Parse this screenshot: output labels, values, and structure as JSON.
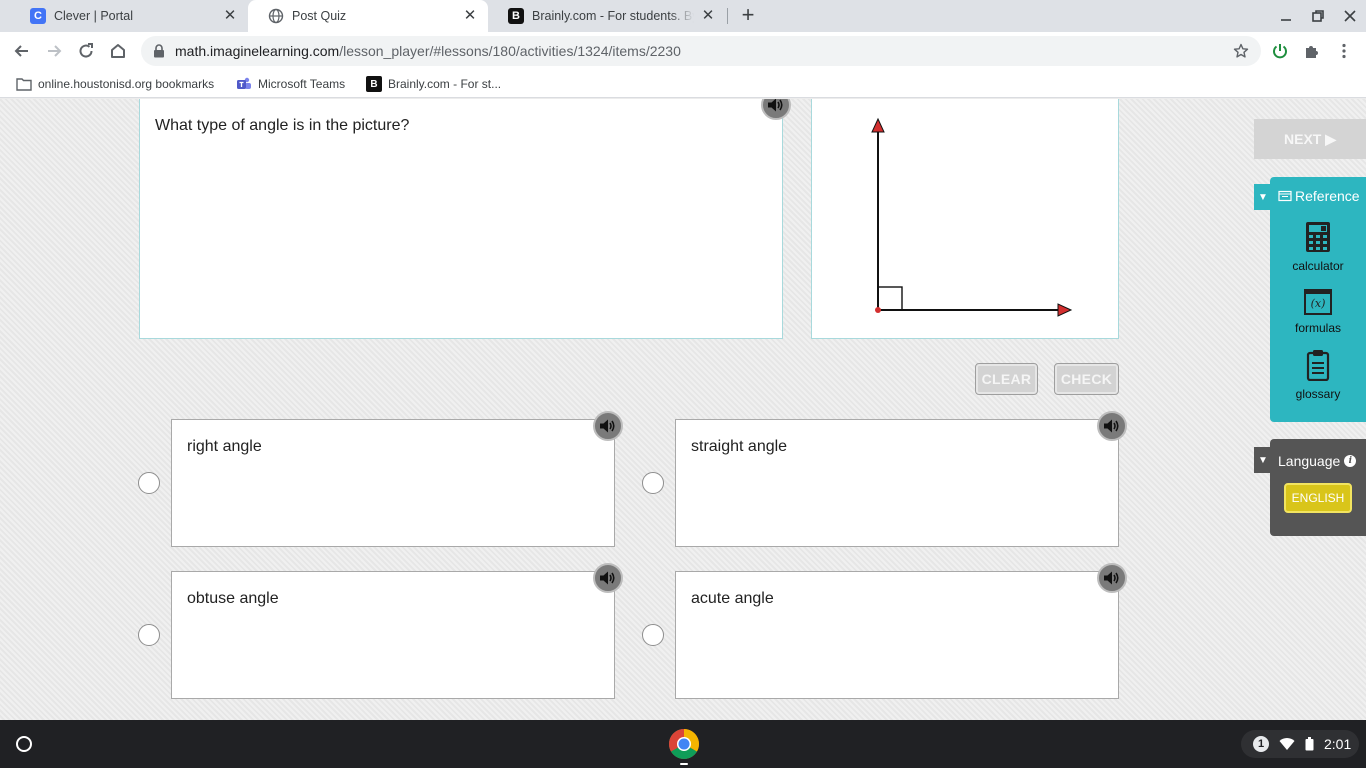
{
  "browser": {
    "tabs": [
      {
        "title": "Clever | Portal",
        "favicon": "clever-icon",
        "favicon_letter": "C",
        "active": false
      },
      {
        "title": "Post Quiz",
        "favicon": "globe-icon",
        "active": true
      },
      {
        "title": "Brainly.com - For students. By st",
        "favicon": "brainly-icon",
        "favicon_letter": "B",
        "active": false
      }
    ],
    "url": {
      "host": "math.imaginelearning.com",
      "path": "/lesson_player/#lessons/180/activities/1324/items/2230"
    },
    "bookmarks": [
      {
        "label": "online.houstonisd.org bookmarks",
        "icon": "folder-icon"
      },
      {
        "label": "Microsoft Teams",
        "icon": "teams-icon"
      },
      {
        "label": "Brainly.com - For st...",
        "icon": "brainly-icon",
        "icon_letter": "B"
      }
    ]
  },
  "quiz": {
    "question": "What type of angle is in the picture?",
    "buttons": {
      "clear": "CLEAR",
      "check": "CHECK",
      "next": "NEXT ▶"
    },
    "choices": [
      {
        "label": "right angle"
      },
      {
        "label": "straight angle"
      },
      {
        "label": "obtuse angle"
      },
      {
        "label": "acute angle"
      }
    ],
    "figure": {
      "type": "right-angle-diagram",
      "arrow_color": "#d32f2f"
    }
  },
  "reference": {
    "title": "Reference",
    "items": [
      {
        "label": "calculator",
        "icon": "calculator-icon"
      },
      {
        "label": "formulas",
        "icon": "formula-icon",
        "glyph": "(x)"
      },
      {
        "label": "glossary",
        "icon": "clipboard-icon"
      }
    ]
  },
  "language": {
    "title": "Language",
    "info_glyph": "i",
    "current": "ENGLISH"
  },
  "taskbar": {
    "notifications": "1",
    "time": "2:01"
  },
  "colors": {
    "accent_teal": "#2db6c0",
    "language_panel": "#555555",
    "english_button": "#d9c51a"
  }
}
